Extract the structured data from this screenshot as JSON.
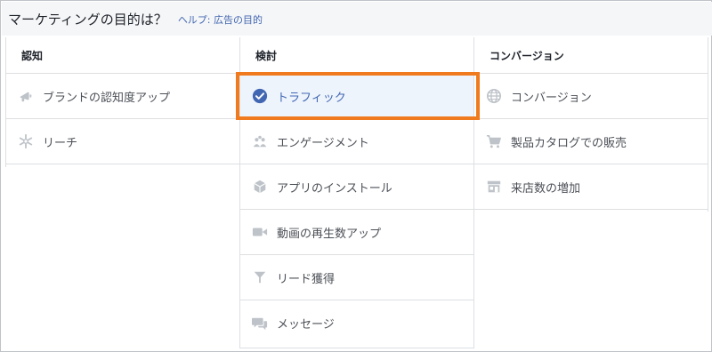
{
  "header": {
    "title": "マーケティングの目的は？",
    "help": "ヘルプ: 広告の目的"
  },
  "columns": [
    {
      "heading": "認知",
      "items": [
        {
          "label": "ブランドの認知度アップ",
          "icon": "megaphone-icon"
        },
        {
          "label": "リーチ",
          "icon": "starburst-icon"
        }
      ]
    },
    {
      "heading": "検討",
      "items": [
        {
          "label": "トラフィック",
          "icon": "checkmark-circle-icon",
          "selected": true
        },
        {
          "label": "エンゲージメント",
          "icon": "people-icon"
        },
        {
          "label": "アプリのインストール",
          "icon": "cube-icon"
        },
        {
          "label": "動画の再生数アップ",
          "icon": "video-camera-icon"
        },
        {
          "label": "リード獲得",
          "icon": "funnel-icon"
        },
        {
          "label": "メッセージ",
          "icon": "chat-bubbles-icon"
        }
      ]
    },
    {
      "heading": "コンバージョン",
      "items": [
        {
          "label": "コンバージョン",
          "icon": "globe-icon"
        },
        {
          "label": "製品カタログでの販売",
          "icon": "shopping-cart-icon"
        },
        {
          "label": "来店数の増加",
          "icon": "storefront-icon"
        }
      ]
    }
  ],
  "colors": {
    "accent": "#4267b2",
    "highlight_border": "#f07a1e",
    "selected_bg": "#eef4fc",
    "icon_gray": "#bec3c9"
  }
}
